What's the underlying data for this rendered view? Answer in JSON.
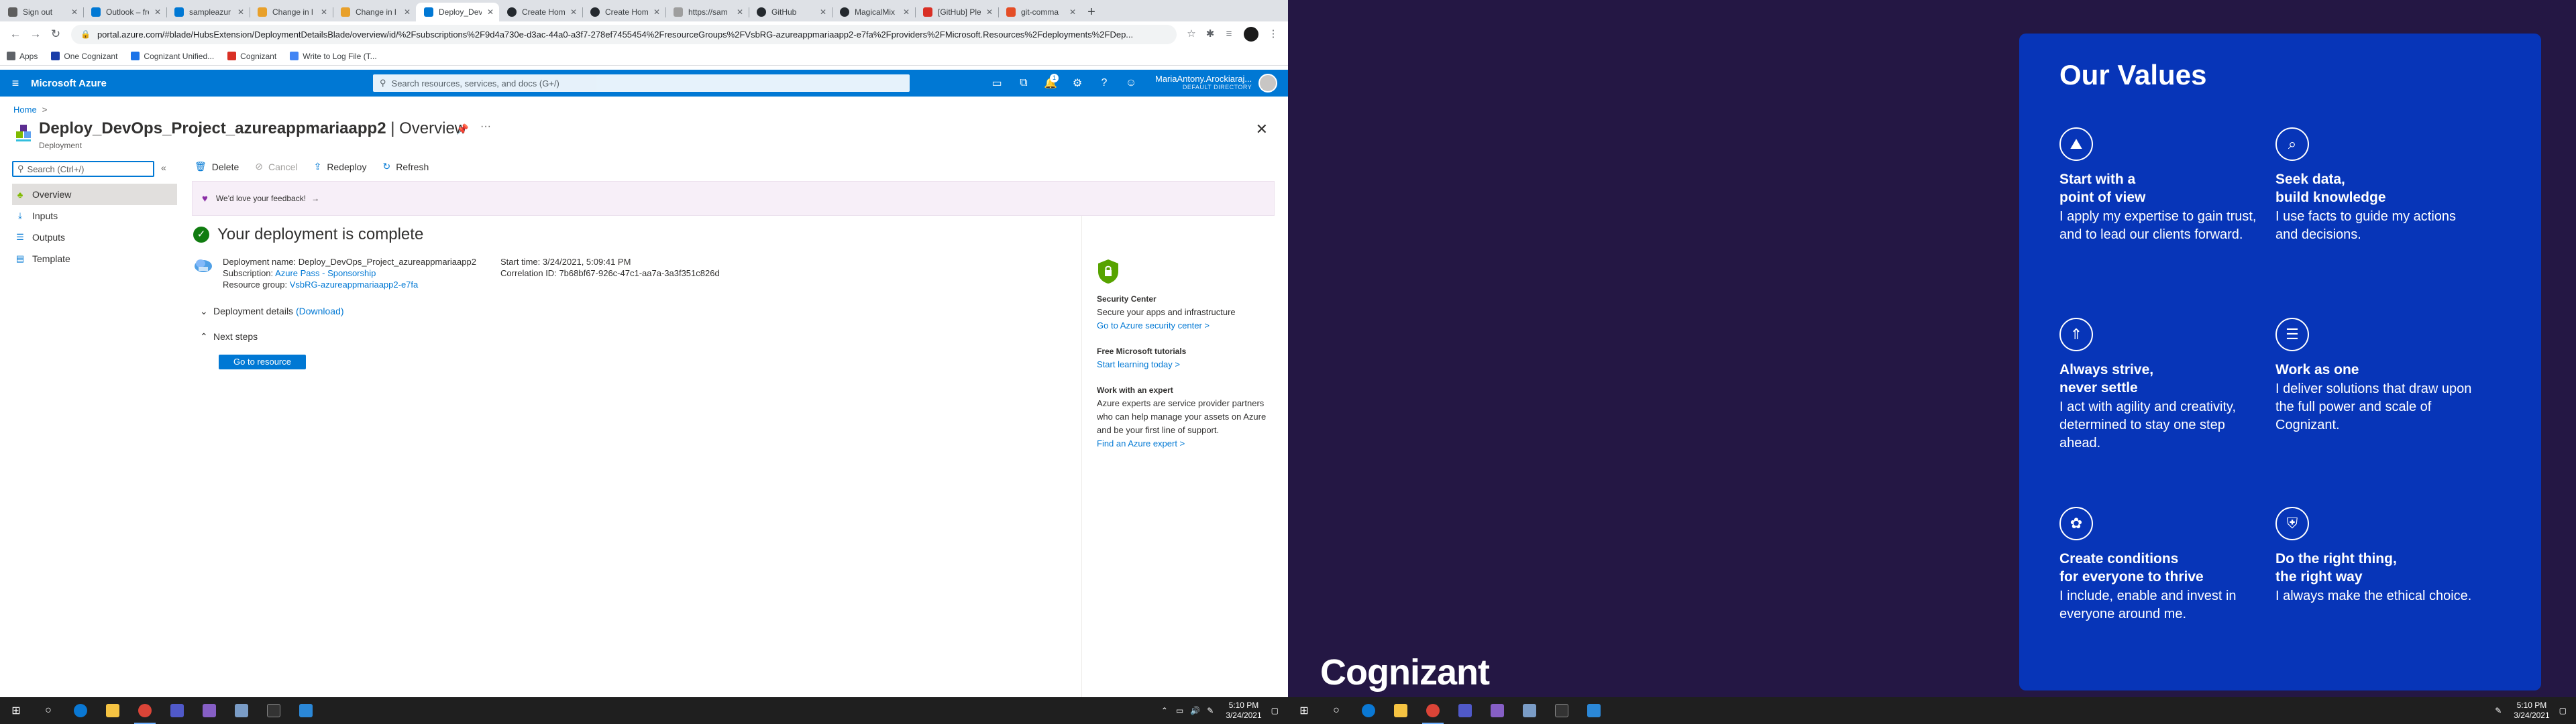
{
  "browser": {
    "tabs": [
      {
        "title": "Sign out",
        "color": "#5e5e5e"
      },
      {
        "title": "Outlook – fre",
        "color": "#0078d4"
      },
      {
        "title": "sampleazur",
        "color": "#0078d4"
      },
      {
        "title": "Change in l",
        "color": "#e8a02a"
      },
      {
        "title": "Change in l",
        "color": "#e8a02a"
      },
      {
        "title": "Deploy_Dev",
        "color": "#0078d4",
        "active": true
      },
      {
        "title": "Create Hom",
        "color": "#24292e"
      },
      {
        "title": "Create Hom",
        "color": "#24292e"
      },
      {
        "title": "https://sam",
        "color": "#9e9e9e"
      },
      {
        "title": "GitHub",
        "color": "#24292e"
      },
      {
        "title": "MagicalMix",
        "color": "#24292e"
      },
      {
        "title": "[GitHub] Ple",
        "color": "#d93025"
      },
      {
        "title": "git-comma",
        "color": "#e44d26"
      }
    ],
    "new_tab": "+",
    "url": "portal.azure.com/#blade/HubsExtension/DeploymentDetailsBlade/overview/id/%2Fsubscriptions%2F9d4a730e-d3ac-44a0-a3f7-278ef7455454%2FresourceGroups%2FVsbRG-azureappmariaapp2-e7fa%2Fproviders%2FMicrosoft.Resources%2Fdeployments%2FDep...",
    "bookmarks": [
      {
        "label": "Apps",
        "color": "#5f6368"
      },
      {
        "label": "One Cognizant",
        "color": "#1a3da8"
      },
      {
        "label": "Cognizant Unified...",
        "color": "#1a73e8"
      },
      {
        "label": "Cognizant",
        "color": "#d93025"
      },
      {
        "label": "Write to Log File (T...",
        "color": "#4285f4"
      }
    ]
  },
  "portal": {
    "brand": "Microsoft Azure",
    "search_placeholder": "Search resources, services, and docs (G+/)",
    "notif_count": "1",
    "account_name": "MariaAntony.Arockiaraj...",
    "account_dir": "DEFAULT DIRECTORY",
    "breadcrumb": "Home",
    "title_bold": "Deploy_DevOps_Project_azureappmariaapp2",
    "title_rest": " | Overview",
    "subtitle": "Deployment",
    "blade_search_placeholder": "Search (Ctrl+/)",
    "menu": [
      {
        "label": "Overview",
        "icon": "overview-icon",
        "active": true
      },
      {
        "label": "Inputs",
        "icon": "inputs-icon"
      },
      {
        "label": "Outputs",
        "icon": "outputs-icon"
      },
      {
        "label": "Template",
        "icon": "template-icon"
      }
    ],
    "commands": {
      "delete": "Delete",
      "cancel": "Cancel",
      "redeploy": "Redeploy",
      "refresh": "Refresh"
    },
    "feedback": "We'd love your feedback!",
    "status_heading": "Your deployment is complete",
    "details": {
      "name_label": "Deployment name:",
      "name_value": "Deploy_DevOps_Project_azureappmariaapp2",
      "sub_label": "Subscription:",
      "sub_value": "Azure Pass - Sponsorship",
      "rg_label": "Resource group:",
      "rg_value": "VsbRG-azureappmariaapp2-e7fa",
      "start_label": "Start time:",
      "start_value": "3/24/2021, 5:09:41 PM",
      "corr_label": "Correlation ID:",
      "corr_value": "7b68bf67-926c-47c1-aa7a-3a3f351c826d"
    },
    "deployment_details": "Deployment details",
    "download": "(Download)",
    "next_steps": "Next steps",
    "go_to_resource": "Go to resource",
    "right_panel": {
      "security_head": "Security Center",
      "security_text": "Secure your apps and infrastructure",
      "security_link": "Go to Azure security center >",
      "tutorials_head": "Free Microsoft tutorials",
      "tutorials_link": "Start learning today >",
      "expert_head": "Work with an expert",
      "expert_text": "Azure experts are service provider partners who can help manage your assets on Azure and be your first line of support.",
      "expert_link": "Find an Azure expert >"
    }
  },
  "taskbar_left": {
    "time": "5:10 PM",
    "date": "3/24/2021"
  },
  "taskbar_right": {
    "time": "5:10 PM",
    "date": "3/24/2021"
  },
  "values_slide": {
    "title": "Our Values",
    "items": [
      {
        "head1": "Start with a",
        "head2": "point of view",
        "body": "I apply my expertise to gain trust, and to lead our clients forward.",
        "icon": "point-of-view-icon"
      },
      {
        "head1": "Seek data,",
        "head2": "build knowledge",
        "body": "I use facts to guide my actions and decisions.",
        "icon": "data-knowledge-icon"
      },
      {
        "head1": "Always strive,",
        "head2": "never settle",
        "body": "I act with agility and creativity, determined to stay one step ahead.",
        "icon": "strive-icon"
      },
      {
        "head1": "Work as one",
        "head2": "",
        "body": "I deliver solutions that draw upon the full power and scale of Cognizant.",
        "icon": "work-as-one-icon"
      },
      {
        "head1": "Create conditions",
        "head2": "for everyone to thrive",
        "body": "I include, enable and invest in everyone around me.",
        "icon": "thrive-icon"
      },
      {
        "head1": "Do the right thing,",
        "head2": "the right way",
        "body": "I always make the ethical choice.",
        "icon": "right-thing-icon"
      }
    ],
    "logo": "Cognizant"
  }
}
